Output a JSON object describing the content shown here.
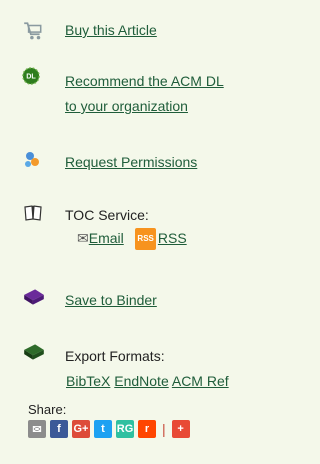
{
  "actions": {
    "buy": {
      "label": "Buy this Article",
      "icon": "cart-icon"
    },
    "recommend": {
      "line1": "Recommend the ACM DL",
      "line2": "to your organization",
      "icon": "dl-badge-icon",
      "badge_text": "DL"
    },
    "permissions": {
      "label": "Request Permissions",
      "icon": "permissions-icon"
    },
    "toc": {
      "title": "TOC Service:",
      "email_label": "Email",
      "rss_badge": "RSS",
      "rss_label": "RSS",
      "icon": "book-icon"
    },
    "binder": {
      "label": "Save to Binder",
      "icon": "binder-icon"
    },
    "export": {
      "title": "Export Formats:",
      "formats": [
        "BibTeX",
        "EndNote",
        "ACM Ref"
      ],
      "icon": "export-book-icon"
    }
  },
  "share": {
    "label": "Share:",
    "buttons": [
      {
        "name": "email-share-icon",
        "glyph": "✉",
        "color": "#8c8c8c"
      },
      {
        "name": "facebook-share-icon",
        "glyph": "f",
        "color": "#3b5998"
      },
      {
        "name": "google-plus-share-icon",
        "glyph": "G+",
        "color": "#dd4b39"
      },
      {
        "name": "twitter-share-icon",
        "glyph": "t",
        "color": "#1da1f2"
      },
      {
        "name": "researchgate-share-icon",
        "glyph": "RG",
        "color": "#2fc0a0"
      },
      {
        "name": "reddit-share-icon",
        "glyph": "r",
        "color": "#ff4500"
      },
      {
        "name": "more-share-icon",
        "glyph": "+",
        "color": "#e84a36"
      }
    ]
  }
}
